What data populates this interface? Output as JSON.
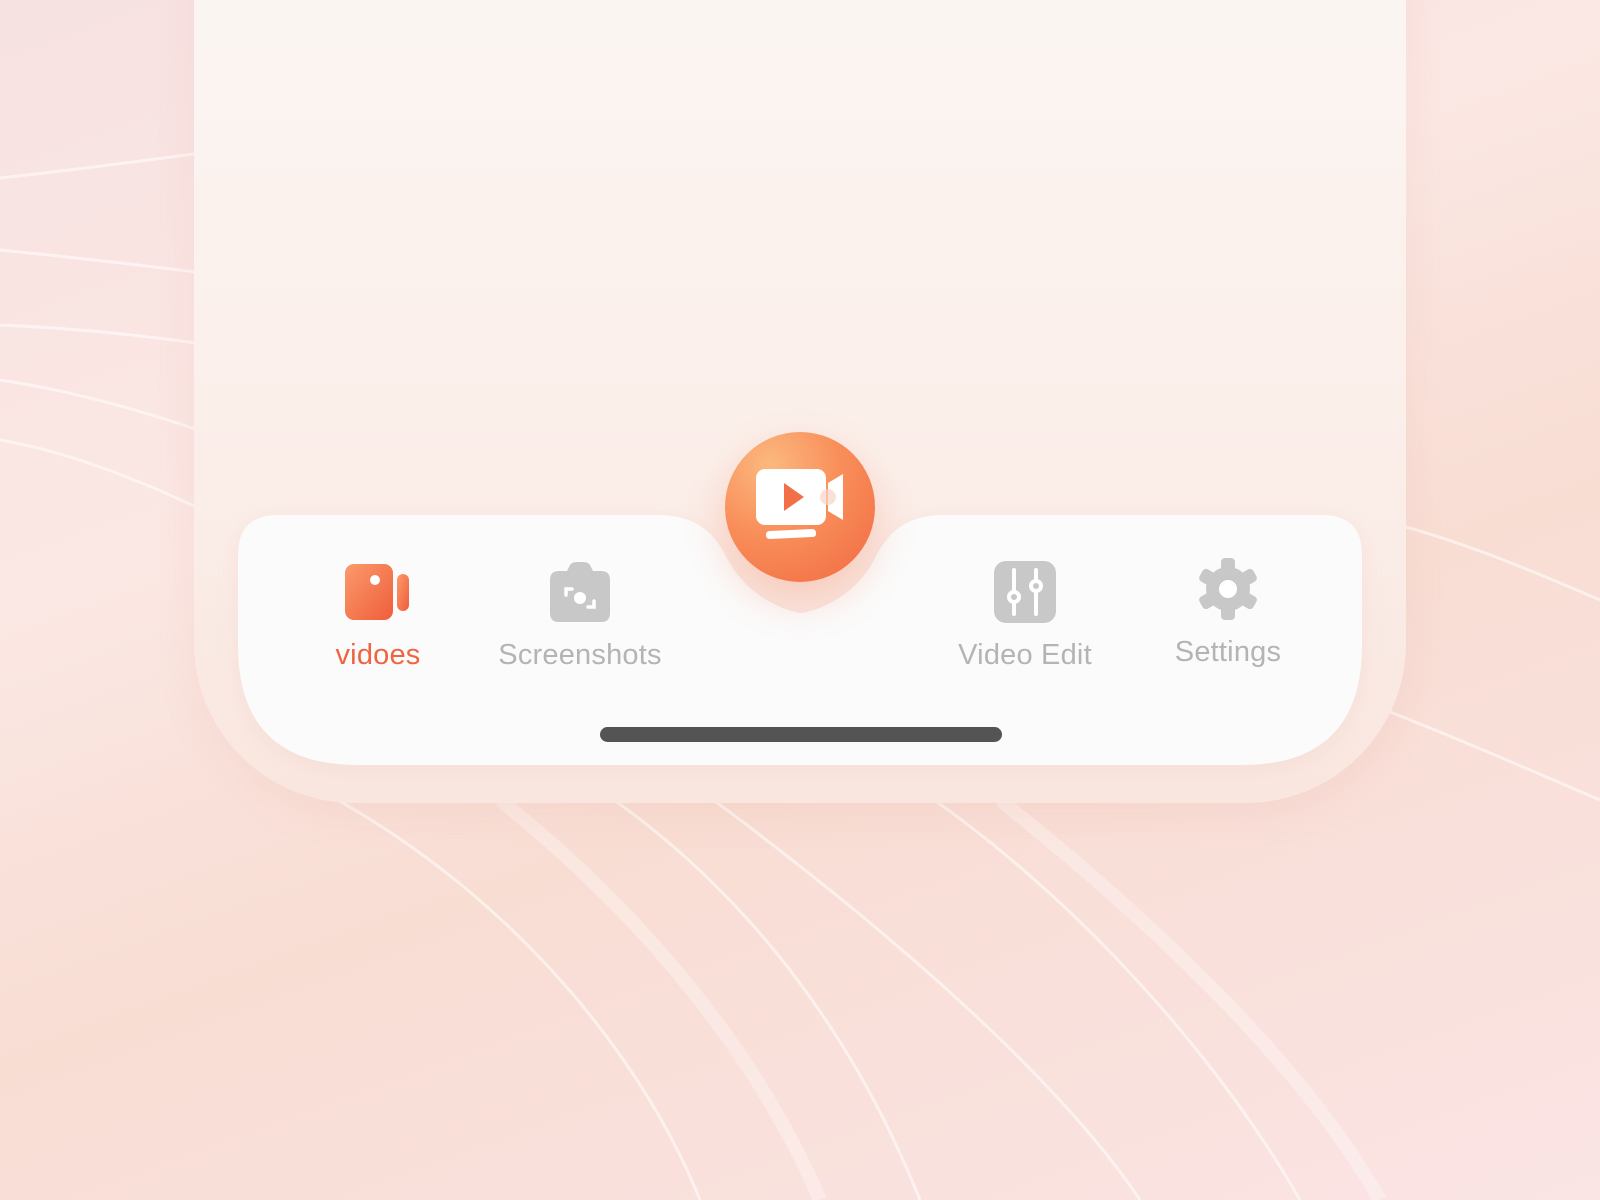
{
  "colors": {
    "accent": "#ee6543",
    "inactive": "#b5b3b3",
    "tabbar_bg": "#fbfbfb",
    "home_indicator": "#545454"
  },
  "fab": {
    "icon": "video-record-icon"
  },
  "tabs": [
    {
      "label": "vidoes",
      "icon": "video-camera-icon",
      "active": true
    },
    {
      "label": "Screenshots",
      "icon": "screenshot-camera-icon",
      "active": false
    },
    {
      "label": "Video Edit",
      "icon": "sliders-icon",
      "active": false
    },
    {
      "label": "Settings",
      "icon": "gear-icon",
      "active": false
    }
  ]
}
